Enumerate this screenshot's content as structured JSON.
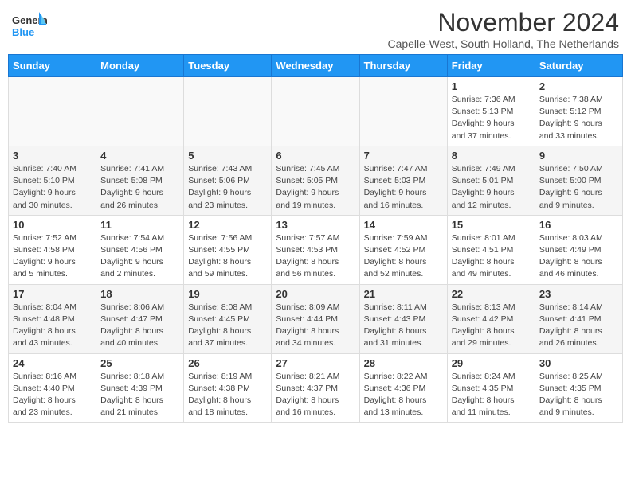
{
  "header": {
    "logo_general": "General",
    "logo_blue": "Blue",
    "month_title": "November 2024",
    "subtitle": "Capelle-West, South Holland, The Netherlands"
  },
  "calendar": {
    "days_of_week": [
      "Sunday",
      "Monday",
      "Tuesday",
      "Wednesday",
      "Thursday",
      "Friday",
      "Saturday"
    ],
    "weeks": [
      [
        {
          "day": "",
          "info": ""
        },
        {
          "day": "",
          "info": ""
        },
        {
          "day": "",
          "info": ""
        },
        {
          "day": "",
          "info": ""
        },
        {
          "day": "",
          "info": ""
        },
        {
          "day": "1",
          "info": "Sunrise: 7:36 AM\nSunset: 5:13 PM\nDaylight: 9 hours and 37 minutes."
        },
        {
          "day": "2",
          "info": "Sunrise: 7:38 AM\nSunset: 5:12 PM\nDaylight: 9 hours and 33 minutes."
        }
      ],
      [
        {
          "day": "3",
          "info": "Sunrise: 7:40 AM\nSunset: 5:10 PM\nDaylight: 9 hours and 30 minutes."
        },
        {
          "day": "4",
          "info": "Sunrise: 7:41 AM\nSunset: 5:08 PM\nDaylight: 9 hours and 26 minutes."
        },
        {
          "day": "5",
          "info": "Sunrise: 7:43 AM\nSunset: 5:06 PM\nDaylight: 9 hours and 23 minutes."
        },
        {
          "day": "6",
          "info": "Sunrise: 7:45 AM\nSunset: 5:05 PM\nDaylight: 9 hours and 19 minutes."
        },
        {
          "day": "7",
          "info": "Sunrise: 7:47 AM\nSunset: 5:03 PM\nDaylight: 9 hours and 16 minutes."
        },
        {
          "day": "8",
          "info": "Sunrise: 7:49 AM\nSunset: 5:01 PM\nDaylight: 9 hours and 12 minutes."
        },
        {
          "day": "9",
          "info": "Sunrise: 7:50 AM\nSunset: 5:00 PM\nDaylight: 9 hours and 9 minutes."
        }
      ],
      [
        {
          "day": "10",
          "info": "Sunrise: 7:52 AM\nSunset: 4:58 PM\nDaylight: 9 hours and 5 minutes."
        },
        {
          "day": "11",
          "info": "Sunrise: 7:54 AM\nSunset: 4:56 PM\nDaylight: 9 hours and 2 minutes."
        },
        {
          "day": "12",
          "info": "Sunrise: 7:56 AM\nSunset: 4:55 PM\nDaylight: 8 hours and 59 minutes."
        },
        {
          "day": "13",
          "info": "Sunrise: 7:57 AM\nSunset: 4:53 PM\nDaylight: 8 hours and 56 minutes."
        },
        {
          "day": "14",
          "info": "Sunrise: 7:59 AM\nSunset: 4:52 PM\nDaylight: 8 hours and 52 minutes."
        },
        {
          "day": "15",
          "info": "Sunrise: 8:01 AM\nSunset: 4:51 PM\nDaylight: 8 hours and 49 minutes."
        },
        {
          "day": "16",
          "info": "Sunrise: 8:03 AM\nSunset: 4:49 PM\nDaylight: 8 hours and 46 minutes."
        }
      ],
      [
        {
          "day": "17",
          "info": "Sunrise: 8:04 AM\nSunset: 4:48 PM\nDaylight: 8 hours and 43 minutes."
        },
        {
          "day": "18",
          "info": "Sunrise: 8:06 AM\nSunset: 4:47 PM\nDaylight: 8 hours and 40 minutes."
        },
        {
          "day": "19",
          "info": "Sunrise: 8:08 AM\nSunset: 4:45 PM\nDaylight: 8 hours and 37 minutes."
        },
        {
          "day": "20",
          "info": "Sunrise: 8:09 AM\nSunset: 4:44 PM\nDaylight: 8 hours and 34 minutes."
        },
        {
          "day": "21",
          "info": "Sunrise: 8:11 AM\nSunset: 4:43 PM\nDaylight: 8 hours and 31 minutes."
        },
        {
          "day": "22",
          "info": "Sunrise: 8:13 AM\nSunset: 4:42 PM\nDaylight: 8 hours and 29 minutes."
        },
        {
          "day": "23",
          "info": "Sunrise: 8:14 AM\nSunset: 4:41 PM\nDaylight: 8 hours and 26 minutes."
        }
      ],
      [
        {
          "day": "24",
          "info": "Sunrise: 8:16 AM\nSunset: 4:40 PM\nDaylight: 8 hours and 23 minutes."
        },
        {
          "day": "25",
          "info": "Sunrise: 8:18 AM\nSunset: 4:39 PM\nDaylight: 8 hours and 21 minutes."
        },
        {
          "day": "26",
          "info": "Sunrise: 8:19 AM\nSunset: 4:38 PM\nDaylight: 8 hours and 18 minutes."
        },
        {
          "day": "27",
          "info": "Sunrise: 8:21 AM\nSunset: 4:37 PM\nDaylight: 8 hours and 16 minutes."
        },
        {
          "day": "28",
          "info": "Sunrise: 8:22 AM\nSunset: 4:36 PM\nDaylight: 8 hours and 13 minutes."
        },
        {
          "day": "29",
          "info": "Sunrise: 8:24 AM\nSunset: 4:35 PM\nDaylight: 8 hours and 11 minutes."
        },
        {
          "day": "30",
          "info": "Sunrise: 8:25 AM\nSunset: 4:35 PM\nDaylight: 8 hours and 9 minutes."
        }
      ]
    ]
  }
}
